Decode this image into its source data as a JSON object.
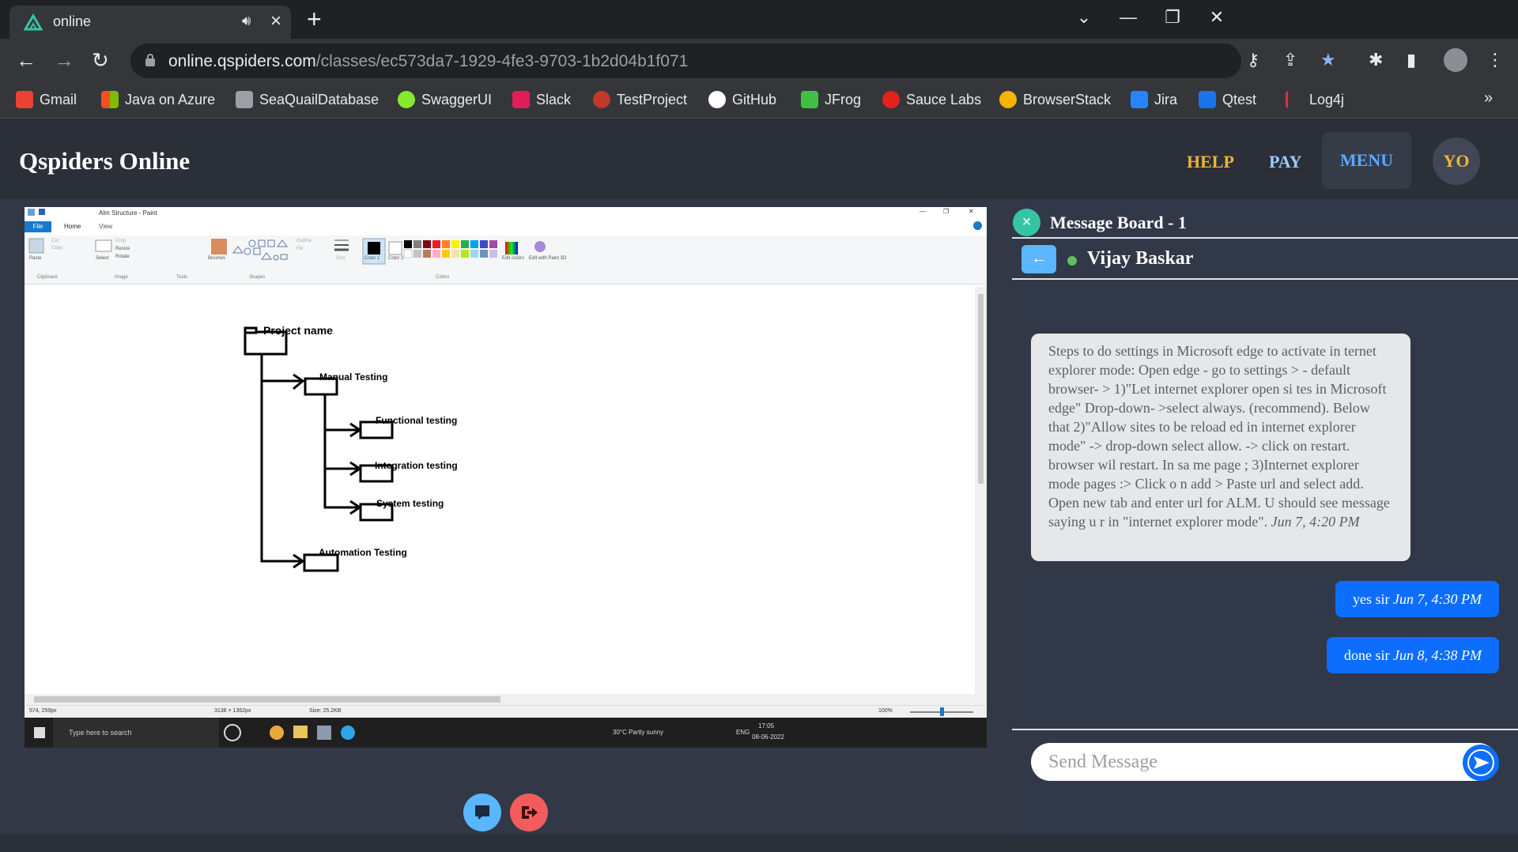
{
  "browser": {
    "tab_title": "online",
    "url_host": "online.qspiders.com",
    "url_path": "/classes/ec573da7-1929-4fe3-9703-1b2d04b1f071",
    "bookmarks": [
      {
        "label": "Gmail",
        "icon": "gmail-icon",
        "color": "#ea4335"
      },
      {
        "label": "Java on Azure",
        "icon": "microsoft-icon",
        "color": "#00a4ef"
      },
      {
        "label": "SeaQuailDatabase",
        "icon": "database-icon",
        "color": "#9aa0a6"
      },
      {
        "label": "SwaggerUI",
        "icon": "swagger-icon",
        "color": "#85ea2d"
      },
      {
        "label": "Slack",
        "icon": "slack-icon",
        "color": "#e01e5a"
      },
      {
        "label": "TestProject",
        "icon": "testproject-icon",
        "color": "#c0392b"
      },
      {
        "label": "GitHub",
        "icon": "github-icon",
        "color": "#ffffff"
      },
      {
        "label": "JFrog",
        "icon": "jfrog-icon",
        "color": "#40be46"
      },
      {
        "label": "Sauce Labs",
        "icon": "saucelabs-icon",
        "color": "#e2231a"
      },
      {
        "label": "BrowserStack",
        "icon": "browserstack-icon",
        "color": "#f4b400"
      },
      {
        "label": "Jira",
        "icon": "jira-icon",
        "color": "#2684ff"
      },
      {
        "label": "Qtest",
        "icon": "qtest-icon",
        "color": "#1a73e8"
      },
      {
        "label": "Log4j",
        "icon": "log4j-icon",
        "color": "#d33"
      }
    ],
    "more_bookmarks": "»"
  },
  "app": {
    "brand": "Qspiders Online",
    "nav_help": "HELP",
    "nav_pay": "PAY",
    "nav_menu": "MENU",
    "avatar_initials": "YO",
    "help_color": "#f0b23a",
    "pay_color": "#9ec9ff",
    "menu_color": "#5aa8ff"
  },
  "paint": {
    "window_title": "Alm Structure - Paint",
    "menu": [
      "File",
      "Home",
      "View"
    ],
    "ribbon_groups": [
      "Clipboard",
      "Image",
      "Tools",
      "Shapes",
      "Colors"
    ],
    "ribbon_buttons": [
      "Paste",
      "Cut",
      "Copy",
      "Select",
      "Crop",
      "Resize",
      "Rotate",
      "Brushes",
      "Outline",
      "Fill",
      "Size",
      "Color 1",
      "Color 2",
      "Edit colors",
      "Edit with Paint 3D"
    ],
    "tree": {
      "root": "Project name",
      "manual": "Manual Testing",
      "functional": "Functional testing",
      "integration": "Integration testing",
      "system": "System testing",
      "automation": "Automation Testing"
    },
    "status": {
      "cursor": "574, 259px",
      "dimensions": "3138 × 1362px",
      "size": "Size: 25.2KB",
      "zoom": "100%"
    },
    "taskbar": {
      "search_placeholder": "Type here to search",
      "weather": "30°C  Partly sunny",
      "lang": "ENG",
      "time": "17:05",
      "date": "08-06-2022"
    }
  },
  "chat": {
    "board_title": "Message Board - 1",
    "contact_name": "Vijay Baskar",
    "messages_in": [
      {
        "text": "Steps to do settings in Microsoft edge to activate in ternet explorer mode: Open edge - go to settings > - default browser- > 1)\"Let internet explorer open si tes in Microsoft edge\" Drop-down- >select always. (recommend). Below that 2)\"Allow sites to be reload ed in internet explorer mode\" -> drop-down select allow. -> click on restart. browser wil restart. In sa me page ; 3)Internet explorer mode pages :> Click o n add > Paste url and select add. Open new tab and enter url for ALM. U should see message saying u r in \"internet explorer mode\".",
        "time": "Jun 7, 4:20 PM"
      }
    ],
    "messages_out": [
      {
        "text": "yes sir",
        "time": "Jun 7, 4:30 PM"
      },
      {
        "text": "done sir",
        "time": "Jun 8, 4:38 PM"
      }
    ],
    "send_placeholder": "Send Message"
  }
}
